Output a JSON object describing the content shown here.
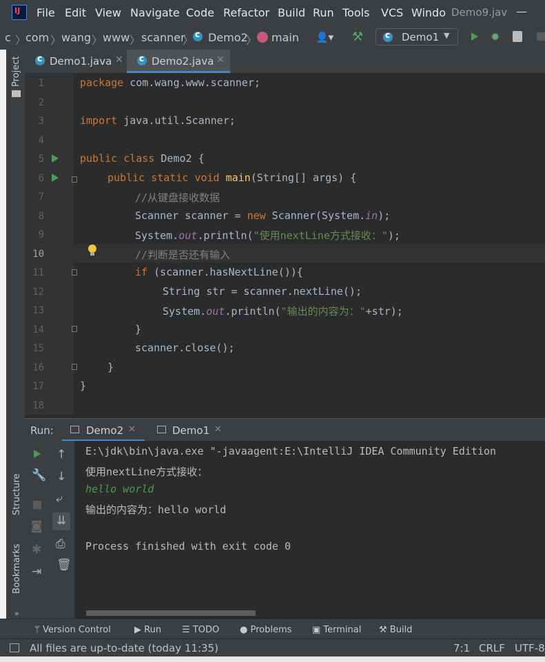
{
  "menu": [
    "File",
    "Edit",
    "View",
    "Navigate",
    "Code",
    "Refactor",
    "Build",
    "Run",
    "Tools",
    "VCS",
    "Windo"
  ],
  "window_title": "Demo9.jav",
  "breadcrumb": [
    "c",
    "com",
    "wang",
    "www",
    "scanner",
    "Demo2",
    "main"
  ],
  "run_config": "Demo1",
  "editor_tabs": [
    {
      "label": "Demo1.java",
      "active": false
    },
    {
      "label": "Demo2.java",
      "active": true
    }
  ],
  "left_strip": {
    "project": "Project",
    "structure": "Structure",
    "bookmarks": "Bookmarks"
  },
  "line_numbers": [
    "1",
    "2",
    "3",
    "4",
    "5",
    "6",
    "7",
    "8",
    "9",
    "10",
    "11",
    "12",
    "13",
    "14",
    "15",
    "16",
    "17",
    "18"
  ],
  "code": {
    "l1_kw": "package",
    "l1_rest": " com.wang.www.scanner;",
    "l3_kw": "import",
    "l3_rest": " java.util.Scanner;",
    "l5_kw": "public class",
    "l5_rest": " Demo2 {",
    "l6_kw": "public static void",
    "l6_fn": " main",
    "l6_rest": "(String[] args) {",
    "l7_cm": "//从键盘接收数据",
    "l8_a": "Scanner scanner = ",
    "l8_kw": "new",
    "l8_b": " Scanner(System.",
    "l8_it": "in",
    "l8_c": ");",
    "l9_a": "System.",
    "l9_it": "out",
    "l9_b": ".println(",
    "l9_st": "\"使用nextLine方式接收：\"",
    "l9_c": ");",
    "l10_cm": "//判断是否还有输入",
    "l11_kw": "if",
    "l11_rest": " (scanner.hasNextLine()){",
    "l12": "String str = scanner.nextLine();",
    "l13_a": "System.",
    "l13_it": "out",
    "l13_b": ".println(",
    "l13_st": "\"输出的内容为：\"",
    "l13_c": "+str);",
    "l14": "}",
    "l15": "scanner.close();",
    "l16": "}",
    "l17": "}"
  },
  "run_panel": {
    "label": "Run:",
    "tabs": [
      "Demo2",
      "Demo1"
    ],
    "output": [
      "E:\\jdk\\bin\\java.exe \"-javaagent:E:\\IntelliJ IDEA Community Edition",
      "使用nextLine方式接收：",
      "hello world",
      "输出的内容为：hello world",
      "",
      "Process finished with exit code 0"
    ]
  },
  "bottom_tabs": [
    "Version Control",
    "Run",
    "TODO",
    "Problems",
    "Terminal",
    "Build"
  ],
  "status": {
    "message": "All files are up-to-date (today 11:35)",
    "position": "7:1",
    "line_sep": "CRLF",
    "encoding": "UTF-8"
  },
  "colors": {
    "keyword": "#cc7832",
    "string": "#6a8759",
    "comment": "#808080",
    "method": "#ffc66d",
    "run_green": "#499c54"
  },
  "icons": [
    "intellij-logo-icon",
    "class-c-icon",
    "method-m-icon",
    "user-icon",
    "hammer-icon",
    "run-icon",
    "debug-icon",
    "coverage-icon",
    "close-icon",
    "wrench-icon",
    "arrow-up-icon",
    "arrow-down-icon",
    "soft-wrap-icon",
    "scroll-end-icon",
    "print-icon",
    "trash-icon",
    "lightbulb-icon"
  ]
}
